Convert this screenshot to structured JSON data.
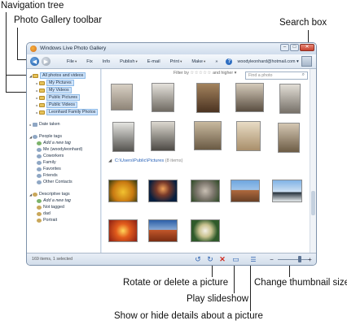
{
  "callouts": {
    "navigation_tree": "Navigation tree",
    "toolbar": "Photo Gallery toolbar",
    "search_box": "Search box",
    "rotate_delete": "Rotate or delete a picture",
    "slideshow": "Play slideshow",
    "thumbnail_size": "Change thumbnail size",
    "details": "Show or hide details about a picture"
  },
  "window": {
    "title": "Windows Live Photo Gallery",
    "controls": {
      "minimize": "–",
      "maximize": "□",
      "close": "✕"
    }
  },
  "toolbar": {
    "back_icon": "back-arrow",
    "forward_icon": "forward-arrow",
    "menu": [
      {
        "label": "File",
        "caret": "▾"
      },
      {
        "label": "Fix",
        "caret": ""
      },
      {
        "label": "Info",
        "caret": ""
      },
      {
        "label": "Publish",
        "caret": "▾"
      },
      {
        "label": "E-mail",
        "caret": ""
      },
      {
        "label": "Print",
        "caret": "▾"
      },
      {
        "label": "Make",
        "caret": "▾"
      },
      {
        "label": "»",
        "caret": ""
      }
    ],
    "help": "?",
    "account": "woodyleonhard@hotmail.com ▾"
  },
  "filter": {
    "label": "Filter by",
    "stars": "☆☆☆☆☆",
    "suffix": "and higher ▾"
  },
  "search": {
    "placeholder": "Find a photo",
    "icon": "search-icon"
  },
  "tree": {
    "all": "All photos and videos",
    "folders": [
      "My Pictures",
      "My Videos",
      "Public Pictures",
      "Public Videos",
      "Leonhard Family Photos"
    ],
    "date_taken": "Date taken",
    "people_tags": "People tags",
    "people_items": [
      "Add a new tag",
      "Me (woodyleonhard)",
      "Coworkers",
      "Family",
      "Favorites",
      "Friends",
      "Other Contacts"
    ],
    "descriptive_tags": "Descriptive tags",
    "descriptive_items": [
      "Add a new tag",
      "Not tagged",
      "dad",
      "Portrait"
    ]
  },
  "group": {
    "path": "C:\\Users\\Public\\Pictures",
    "count": "(8 items)"
  },
  "status": {
    "text": "169 items, 1 selected"
  },
  "statusbar_icons": {
    "rotate_left": "↺",
    "rotate_right": "↻",
    "delete": "✕",
    "slideshow": "▭",
    "details": "☰",
    "zoom_out": "−",
    "zoom_in": "+"
  }
}
